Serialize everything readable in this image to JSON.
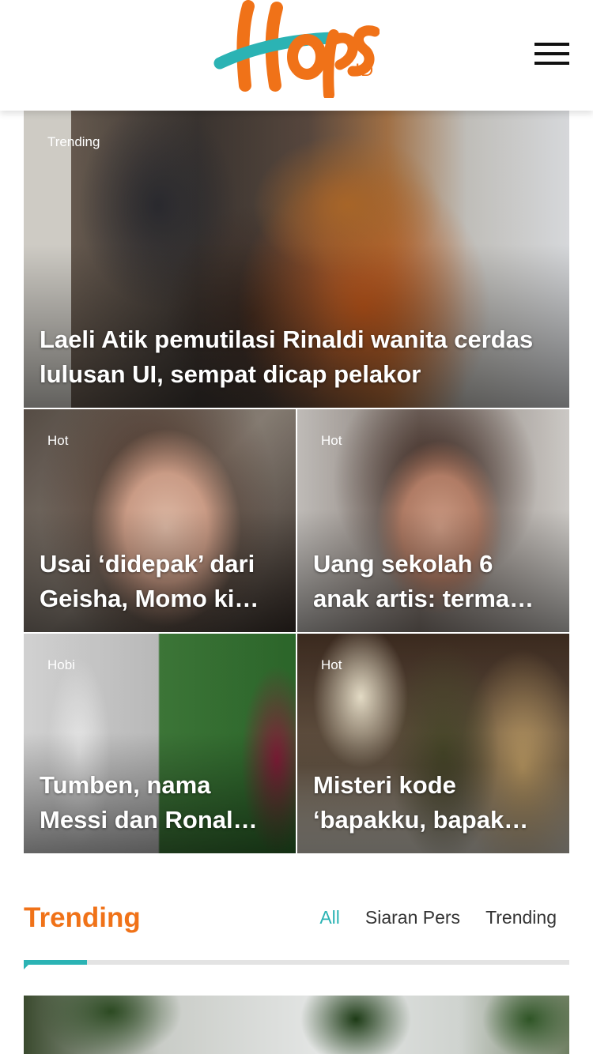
{
  "brand": {
    "logo_text": "Hops",
    "logo_suffix": ".ID",
    "accent": "#f07218",
    "teal": "#2bb3b4"
  },
  "featured": {
    "category": "Trending",
    "title": "Laeli Atik pemutilasi Rinaldi wanita cerdas lulusan UI, sempat dicap pelakor"
  },
  "grid": [
    {
      "category": "Hot",
      "title": "Usai ‘didepak’ dari Geisha, Momo ki…"
    },
    {
      "category": "Hot",
      "title": "Uang sekolah 6 anak artis: terma…"
    },
    {
      "category": "Hobi",
      "title": "Tumben, nama Messi dan Ronal…"
    },
    {
      "category": "Hot",
      "title": "Misteri kode ‘bapakku, bapak…"
    }
  ],
  "trending_section": {
    "title": "Trending",
    "tabs": [
      "All",
      "Siaran Pers",
      "Trending"
    ],
    "active_tab": "All"
  }
}
